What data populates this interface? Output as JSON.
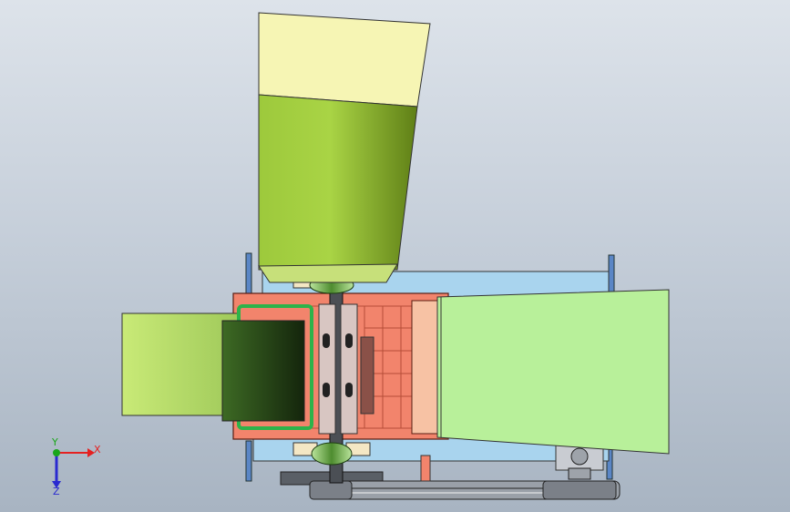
{
  "view": {
    "background_top": "#dde3ea",
    "background_bottom": "#a8b4c2"
  },
  "colors": {
    "hopper_yellow": "#f6f5b4",
    "hopper_green": "#9ecb3a",
    "chute_green": "#b8f09a",
    "frame_blue": "#a9d4ee",
    "body_red": "#f2846c",
    "blade_gray": "#d8c6c2",
    "pulley_green": "#4fa84f",
    "bearing_green": "#8fd06a",
    "axis_x": "#e52020",
    "axis_y": "#1aa61a",
    "axis_z": "#2a2ad0"
  },
  "triad": {
    "x_label": "X",
    "y_label": "Y",
    "z_label": "Z",
    "icon": "coordinate-triad-icon"
  }
}
